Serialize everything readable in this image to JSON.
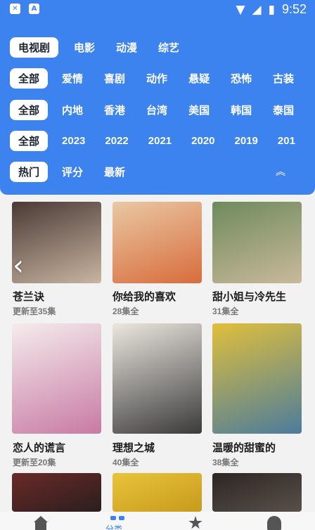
{
  "statusbar": {
    "left_icons": [
      "close-icon",
      "a-icon"
    ],
    "time": "9:52"
  },
  "filters": {
    "type_row": {
      "items": [
        "电视剧",
        "电影",
        "动漫",
        "综艺"
      ],
      "active": 0
    },
    "genre_row": {
      "items": [
        "全部",
        "爱情",
        "喜剧",
        "动作",
        "悬疑",
        "恐怖",
        "古装"
      ],
      "active": 0
    },
    "region_row": {
      "items": [
        "全部",
        "内地",
        "香港",
        "台湾",
        "美国",
        "韩国",
        "泰国"
      ],
      "active": 0
    },
    "year_row": {
      "items": [
        "全部",
        "2023",
        "2022",
        "2021",
        "2020",
        "2019",
        "201"
      ],
      "active": 0
    },
    "sort_row": {
      "items": [
        "热门",
        "评分",
        "最新"
      ],
      "active": 0
    },
    "collapse_icon": "chevron-up-double-icon"
  },
  "shows": [
    {
      "title": "苍兰诀",
      "status": "更新至35集",
      "colors": [
        "#4a3a36",
        "#c8b4a0"
      ]
    },
    {
      "title": "你给我的喜欢",
      "status": "28集全",
      "colors": [
        "#e9c8a4",
        "#d86c3c"
      ]
    },
    {
      "title": "甜小姐与冷先生",
      "status": "31集全",
      "colors": [
        "#6f8a5c",
        "#c9b99b"
      ]
    },
    {
      "title": "恋人的谎言",
      "status": "更新至20集",
      "colors": [
        "#f4ecec",
        "#c87aa4"
      ]
    },
    {
      "title": "理想之城",
      "status": "40集全",
      "colors": [
        "#ebe6df",
        "#3b3b3b"
      ]
    },
    {
      "title": "温暖的甜蜜的",
      "status": "38集全",
      "colors": [
        "#e0bf3c",
        "#4c7c9c"
      ]
    },
    {
      "title": "",
      "status": "",
      "colors": [
        "#6a2a28",
        "#2b1e1e"
      ]
    },
    {
      "title": "",
      "status": "",
      "colors": [
        "#e9c43a",
        "#c79a1c"
      ]
    },
    {
      "title": "",
      "status": "",
      "colors": [
        "#2c2624",
        "#595049"
      ]
    }
  ],
  "bottom_nav": {
    "items": [
      "home-icon",
      "category-icon",
      "star-icon",
      "user-icon"
    ],
    "active_label": "分类",
    "accent": "#3c83f0"
  }
}
